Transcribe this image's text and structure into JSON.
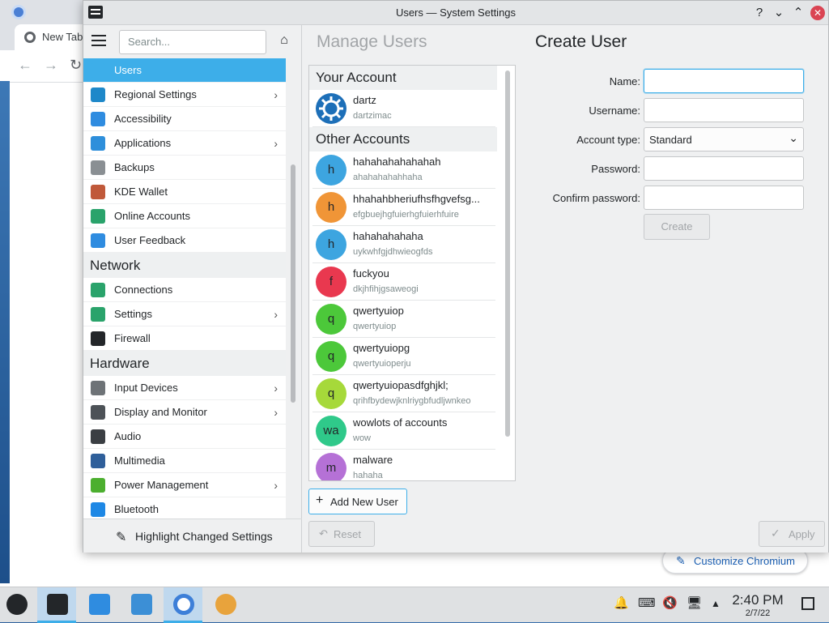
{
  "browser": {
    "tab_label": "New Tab",
    "customize_label": "Customize Chromium"
  },
  "window": {
    "title": "Users — System Settings",
    "help_label": "?",
    "minimize_label": "⌄",
    "maximize_label": "⌃",
    "close_label": "✕"
  },
  "sidebar": {
    "search_placeholder": "Search...",
    "items_top": [
      {
        "label": "Users",
        "icon": "users-icon",
        "color": "#3daee9",
        "chevron": false,
        "active": true
      },
      {
        "label": "Regional Settings",
        "icon": "regional-settings-icon",
        "color": "#1e88c9",
        "chevron": true
      },
      {
        "label": "Accessibility",
        "icon": "accessibility-icon",
        "color": "#2f8ce0",
        "chevron": false
      },
      {
        "label": "Applications",
        "icon": "applications-icon",
        "color": "#2e8fdb",
        "chevron": true
      },
      {
        "label": "Backups",
        "icon": "backups-icon",
        "color": "#8a8f93",
        "chevron": false
      },
      {
        "label": "KDE Wallet",
        "icon": "kde-wallet-icon",
        "color": "#c0593a",
        "chevron": false
      },
      {
        "label": "Online Accounts",
        "icon": "online-accounts-icon",
        "color": "#2aa36b",
        "chevron": false
      },
      {
        "label": "User Feedback",
        "icon": "user-feedback-icon",
        "color": "#2f8ce0",
        "chevron": false
      }
    ],
    "section_network": "Network",
    "items_network": [
      {
        "label": "Connections",
        "icon": "connections-icon",
        "color": "#2aa36b",
        "chevron": false
      },
      {
        "label": "Settings",
        "icon": "network-settings-icon",
        "color": "#2aa36b",
        "chevron": true
      },
      {
        "label": "Firewall",
        "icon": "firewall-icon",
        "color": "#232629",
        "chevron": false
      }
    ],
    "section_hardware": "Hardware",
    "items_hardware": [
      {
        "label": "Input Devices",
        "icon": "input-devices-icon",
        "color": "#6e7377",
        "chevron": true
      },
      {
        "label": "Display and Monitor",
        "icon": "display-monitor-icon",
        "color": "#4d5257",
        "chevron": true
      },
      {
        "label": "Audio",
        "icon": "audio-icon",
        "color": "#3b3f43",
        "chevron": false
      },
      {
        "label": "Multimedia",
        "icon": "multimedia-icon",
        "color": "#2f5f9a",
        "chevron": false
      },
      {
        "label": "Power Management",
        "icon": "power-management-icon",
        "color": "#4caf2f",
        "chevron": true
      },
      {
        "label": "Bluetooth",
        "icon": "bluetooth-icon",
        "color": "#1e88e5",
        "chevron": false
      }
    ],
    "highlight_label": "Highlight Changed Settings"
  },
  "main": {
    "heading_left": "Manage Users",
    "heading_right": "Create User",
    "your_account_label": "Your Account",
    "your_account": {
      "name": "dartz",
      "login": "dartzimac"
    },
    "other_accounts_label": "Other Accounts",
    "accounts": [
      {
        "initial": "h",
        "name": "hahahahahahahah",
        "login": "ahahahahahhaha",
        "color": "#3da5e0"
      },
      {
        "initial": "h",
        "name": "hhahahbheriufhsfhgvefsg...",
        "login": "efgbuejhgfuierhgfuierhfuire",
        "color": "#f09537"
      },
      {
        "initial": "h",
        "name": "hahahahahaha",
        "login": "uykwhfgjdhwieogfds",
        "color": "#3da5e0"
      },
      {
        "initial": "f",
        "name": "fuckyou",
        "login": "dkjhfihjgsaweogi",
        "color": "#e9384f"
      },
      {
        "initial": "q",
        "name": "qwertyuiop",
        "login": "qwertyuiop",
        "color": "#4cc83a"
      },
      {
        "initial": "q",
        "name": "qwertyuiopg",
        "login": "qwertyuioperju",
        "color": "#4cc83a"
      },
      {
        "initial": "q",
        "name": "qwertyuiopasdfghjkl;",
        "login": "qrihfbydewjknlriygbfudljwnkeo",
        "color": "#a6d93a"
      },
      {
        "initial": "wa",
        "name": "wowlots of accounts",
        "login": "wow",
        "color": "#2fc98a"
      },
      {
        "initial": "m",
        "name": "malware",
        "login": "hahaha",
        "color": "#b571d6"
      }
    ],
    "add_user_label": "Add New User",
    "reset_label": "Reset",
    "apply_label": "Apply"
  },
  "form": {
    "name_label": "Name:",
    "name_value": "",
    "username_label": "Username:",
    "username_value": "",
    "account_type_label": "Account type:",
    "account_type_value": "Standard",
    "password_label": "Password:",
    "password_value": "",
    "confirm_label": "Confirm password:",
    "confirm_value": "",
    "create_label": "Create"
  },
  "taskbar": {
    "time": "2:40 PM",
    "date": "2/7/22"
  }
}
